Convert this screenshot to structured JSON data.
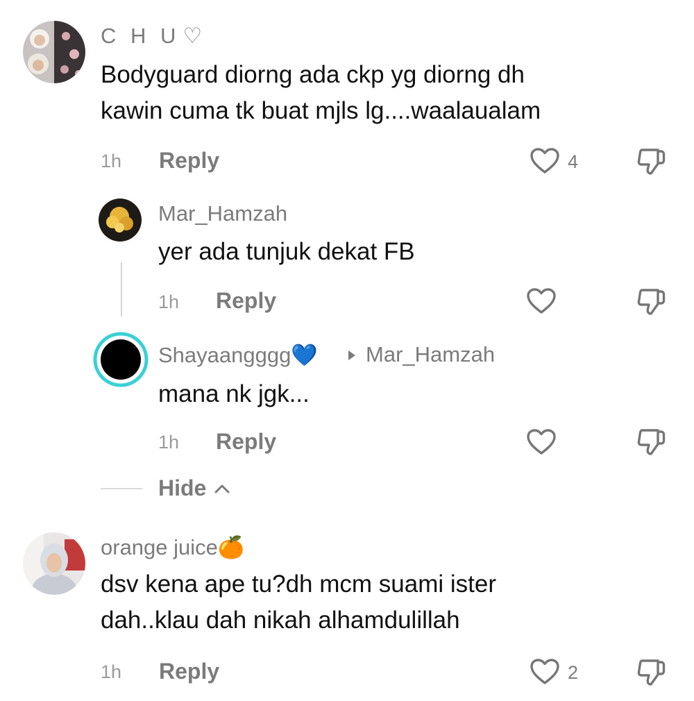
{
  "comments": [
    {
      "username": "C H U",
      "username_emoji": "♡",
      "lines": [
        "Bodyguard diorng ada ckp yg diorng dh",
        "kawin cuma tk buat mjls lg....waalaualam"
      ],
      "time": "1h",
      "reply_label": "Reply",
      "like_count": "4",
      "replies": [
        {
          "username": "Mar_Hamzah",
          "text": "yer ada tunjuk dekat FB",
          "time": "1h",
          "reply_label": "Reply"
        },
        {
          "username": "Shayaangggg",
          "username_emoji": "💙",
          "reply_to": "Mar_Hamzah",
          "text": "mana nk jgk...",
          "time": "1h",
          "reply_label": "Reply"
        }
      ],
      "hide_label": "Hide"
    },
    {
      "username": "orange juice",
      "username_emoji": "🍊",
      "lines": [
        "dsv kena ape tu?dh mcm suami ister",
        "dah..klau dah nikah alhamdulillah"
      ],
      "time": "1h",
      "reply_label": "Reply",
      "like_count": "2"
    }
  ],
  "colors": {
    "text": "#111111",
    "secondary": "#7b7b7b",
    "avatar_ring": "#3ad0d6",
    "heart_emoji": "#1e88e5",
    "orange_emoji": "#f08a1c"
  },
  "icons": [
    "heart-outline-icon",
    "dislike-icon",
    "chevron-up-icon",
    "reply-arrow-icon"
  ]
}
